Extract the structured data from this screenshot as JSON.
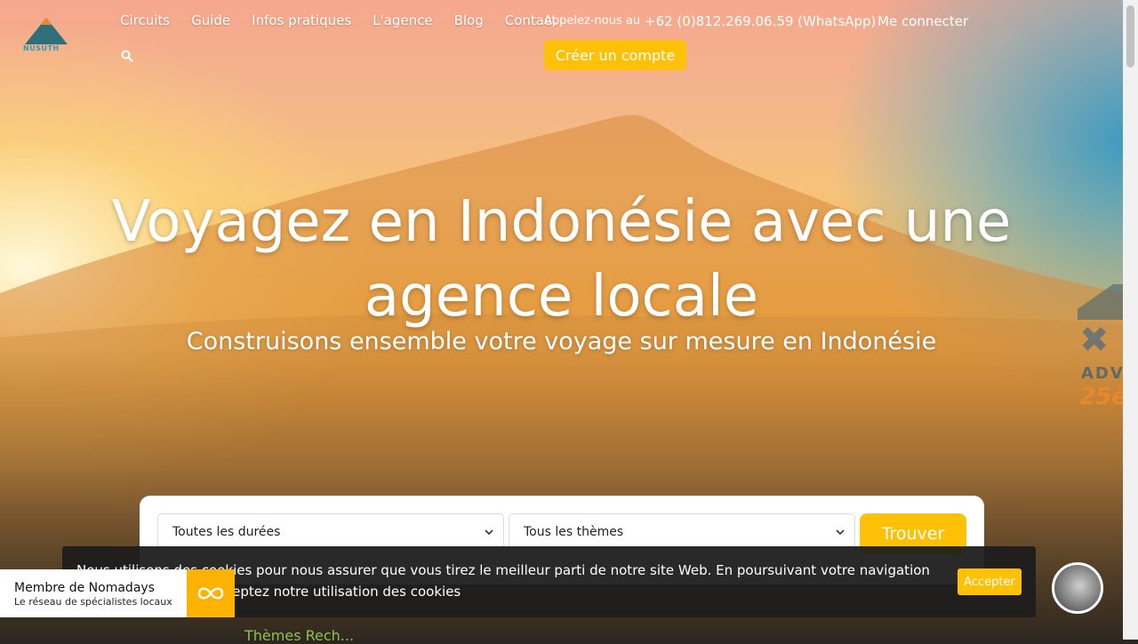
{
  "brand": {
    "logo_text": "NUSUTH"
  },
  "nav": {
    "items": [
      "Circuits",
      "Guide",
      "Infos pratiques",
      "L'agence",
      "Blog",
      "Contact"
    ]
  },
  "contact": {
    "call_label": "Appelez-nous au",
    "phone": "+62 (0)812.269.06.59 (WhatsApp)",
    "login": "Me connecter",
    "create_account": "Créer un compte"
  },
  "hero": {
    "title": "Voyagez en Indonésie avec une agence locale",
    "subtitle": "Construisons ensemble votre voyage sur mesure en Indonésie",
    "side_badge": {
      "line1": "ADV",
      "line2": "25è"
    }
  },
  "search": {
    "duration_value": "Toutes les durées",
    "theme_value": "Tous les thèmes",
    "submit": "Trouver"
  },
  "cookie": {
    "text": "Nous utilisons des cookies pour nous assurer que vous tirez le meilleur parti de notre site Web. En poursuivant votre navigation sur notre site, vous acceptez notre utilisation des cookies",
    "accept": "Accepter"
  },
  "nomadays": {
    "title": "Membre de Nomadays",
    "subtitle": "Le réseau de spécialistes locaux"
  },
  "below_fold_peek": "Thèmes Rech...",
  "colors": {
    "accent": "#ffc107",
    "nomadays_orange": "#ffb300",
    "cookie_bg": "#1e1e1e"
  },
  "icons": {
    "search": "search-icon",
    "chevron": "chevron-down-icon",
    "infinity": "infinity-icon",
    "chat": "chat-avatar"
  }
}
